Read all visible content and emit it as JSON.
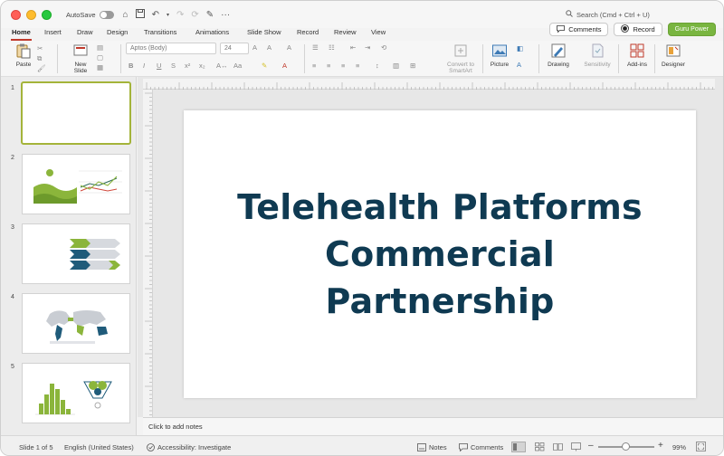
{
  "titlebar": {
    "autosave_label": "AutoSave",
    "search_placeholder": "Search (Cmd + Ctrl + U)"
  },
  "tabs": [
    "Home",
    "Insert",
    "Draw",
    "Design",
    "Transitions",
    "Animations",
    "Slide Show",
    "Record",
    "Review",
    "View"
  ],
  "ribbon_right": {
    "comments": "Comments",
    "record": "Record",
    "guru": "Guru Power"
  },
  "ribbon": {
    "paste": "Paste",
    "new_slide_1": "New",
    "new_slide_2": "Slide",
    "font_name": "Aptos (Body)",
    "font_size": "24",
    "convert_1": "Convert to",
    "convert_2": "SmartArt",
    "picture": "Picture",
    "drawing": "Drawing",
    "sensitivity": "Sensitivity",
    "addins": "Add-ins",
    "designer": "Designer"
  },
  "thumbnails": [
    {
      "num": "1"
    },
    {
      "num": "2"
    },
    {
      "num": "3"
    },
    {
      "num": "4"
    },
    {
      "num": "5"
    }
  ],
  "slide": {
    "title_line1": "Telehealth Platforms",
    "title_line2": "Commercial",
    "title_line3": "Partnership"
  },
  "notes_placeholder": "Click to add notes",
  "statusbar": {
    "slide_count": "Slide 1 of 5",
    "language": "English (United States)",
    "accessibility": "Accessibility: Investigate",
    "notes": "Notes",
    "comments": "Comments",
    "zoom": "99%"
  },
  "colors": {
    "accent_red": "#c0392b",
    "title_navy": "#0f3a52",
    "guru_green": "#79b540",
    "thumb_selected": "#a4b43a"
  }
}
